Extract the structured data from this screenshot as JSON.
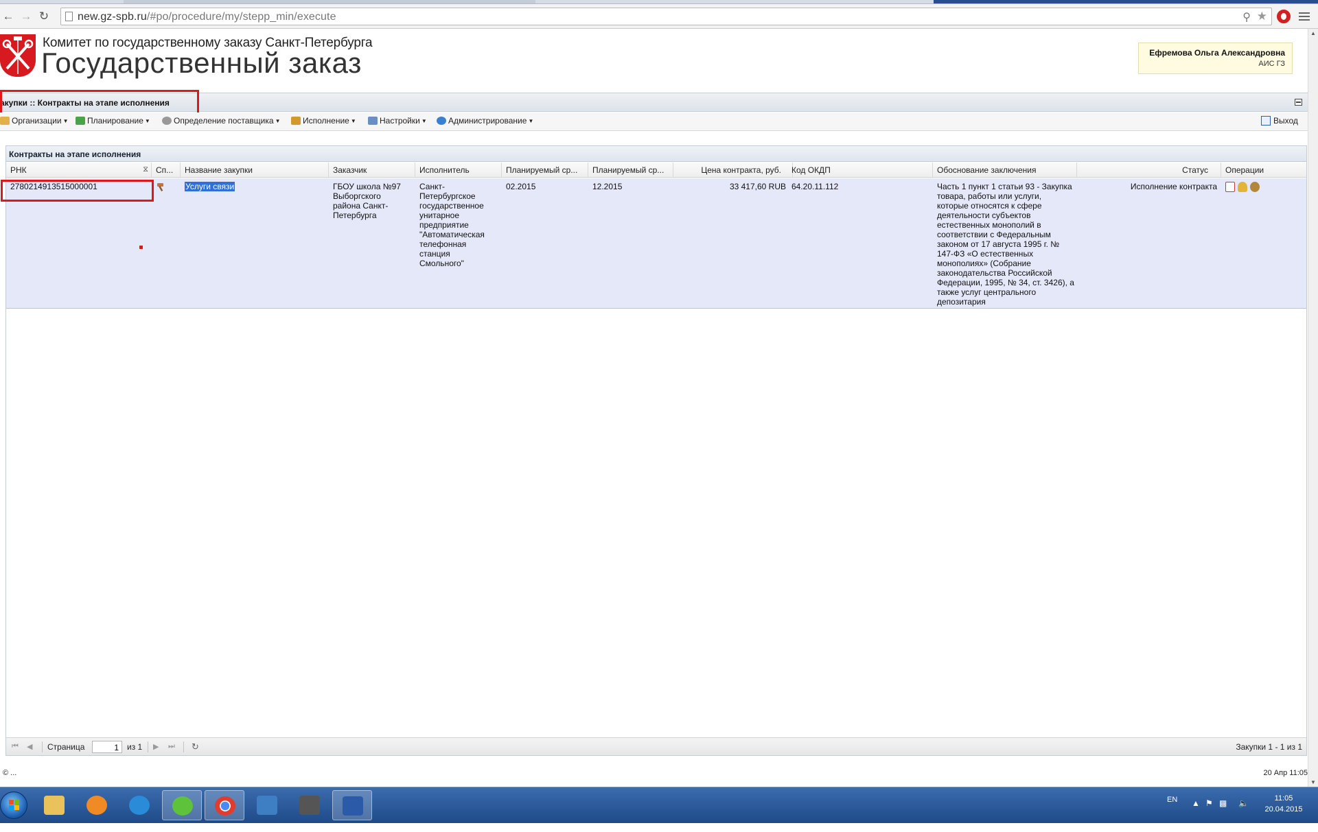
{
  "browser": {
    "url_host": "new.gz-spb.ru",
    "url_path": "/#po/procedure/my/stepp_min/execute"
  },
  "header": {
    "org_name": "Комитет по государственному заказу Санкт-Петербурга",
    "brand_title": "Государственный заказ",
    "user_name": "Ефремова Ольга Александровна",
    "system_name": "АИС ГЗ"
  },
  "breadcrumb": {
    "text": "акупки :: Контракты на этапе исполнения"
  },
  "menu": {
    "items": [
      {
        "label": "Организации"
      },
      {
        "label": "Планирование"
      },
      {
        "label": "Определение поставщика"
      },
      {
        "label": "Исполнение"
      },
      {
        "label": "Настройки"
      },
      {
        "label": "Администрирование"
      }
    ],
    "exit_label": "Выход"
  },
  "grid": {
    "title": "Контракты на этапе исполнения",
    "columns": [
      "РНК",
      "Сп...",
      "Название закупки",
      "Заказчик",
      "Исполнитель",
      "Планируемый ср...",
      "Планируемый ср...",
      "Цена контракта, руб.",
      "Код ОКДП",
      "Обоснование заключения",
      "Статус",
      "Операции"
    ],
    "rows": [
      {
        "rnk": "2780214913515000001",
        "name": "Услуги связи",
        "customer": "ГБОУ школа №97 Выборгского района Санкт-Петербурга",
        "executor": "Санкт-Петербургское государственное унитарное предприятие \"Автоматическая телефонная станция Смольного\"",
        "planned_start": "02.2015",
        "planned_end": "12.2015",
        "price": "33 417,60 RUB",
        "okdp": "64.20.11.112",
        "basis": "Часть 1 пункт 1 статьи 93 - Закупка товара, работы или услуги, которые относятся к сфере деятельности субъектов естественных монополий в соответствии с Федеральным законом от 17 августа 1995 г. № 147-ФЗ «О естественных монополиях» (Собрание законодательства Российской Федерации, 1995, № 34, ст. 3426), а также услуг центрального депозитария",
        "status": "Исполнение контракта"
      }
    ]
  },
  "pager": {
    "page_label": "Страница",
    "page_value": "1",
    "of_label": "из 1",
    "info": "Закупки 1 - 1 из 1"
  },
  "footer": {
    "left": "© ...",
    "right": "20 Апр 11:05"
  },
  "taskbar": {
    "lang": "EN",
    "time": "11:05",
    "date": "20.04.2015"
  },
  "colors": {
    "highlight_red": "#e0161b",
    "row_selected": "#e4e8f8",
    "brand_red": "#d71920"
  }
}
